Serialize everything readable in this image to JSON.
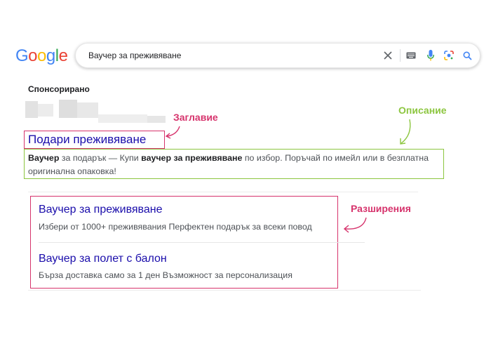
{
  "logo": {
    "letters": [
      "G",
      "o",
      "o",
      "g",
      "l",
      "e"
    ],
    "colors": [
      "#4285F4",
      "#EA4335",
      "#FBBC05",
      "#4285F4",
      "#34A853",
      "#EA4335"
    ]
  },
  "search": {
    "value": "Ваучер за преживяване",
    "icons": [
      "close-icon",
      "keyboard-icon",
      "mic-icon",
      "lens-icon",
      "search-icon"
    ]
  },
  "results": {
    "sponsored_label": "Спонсорирано",
    "ad": {
      "title": "Подари преживяване",
      "description_parts": [
        {
          "text": "Ваучер",
          "bold": true
        },
        {
          "text": " за подарък — Купи ",
          "bold": false
        },
        {
          "text": "ваучер за преживяване",
          "bold": true
        },
        {
          "text": " по избор. Поръчай по имейл или в безплатна оригинална опаковка!",
          "bold": false
        }
      ]
    },
    "extensions": [
      {
        "title": "Ваучер за преживяване",
        "desc": "Избери от 1000+ преживявания Перфектен подарък за всеки повод"
      },
      {
        "title": "Ваучер за полет с балон",
        "desc": "Бърза доставка само за 1 ден Възможност за персонализация"
      }
    ]
  },
  "annotations": {
    "title": "Заглавие",
    "description": "Описание",
    "extensions": "Разширения"
  },
  "colors": {
    "accent_pink": "#d6336c",
    "accent_green": "#8cc63f",
    "link_blue": "#1a0dab"
  }
}
